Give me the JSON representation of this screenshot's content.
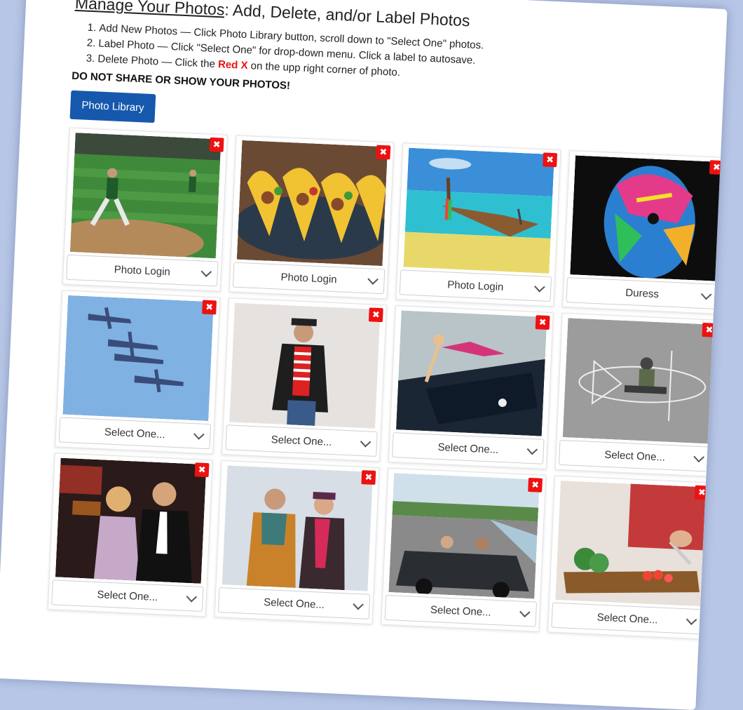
{
  "header": {
    "title_underlined": "Manage Your Photos",
    "title_rest": ": Add, Delete, and/or Label Photos"
  },
  "instructions": [
    {
      "text": "Add New Photos — Click Photo Library button, scroll down to \"Select One\" photos."
    },
    {
      "text": "Label Photo — Click \"Select One\" for drop-down menu. Click a label to autosave."
    },
    {
      "pre": "Delete Photo — Click the ",
      "highlight": "Red X",
      "post": " on the upp right corner of photo."
    }
  ],
  "warning": "DO NOT SHARE OR SHOW YOUR PHOTOS!",
  "library_button": "Photo Library",
  "delete_glyph": "✖",
  "photos": [
    {
      "subject": "baseball-pitcher",
      "label": "Photo Login"
    },
    {
      "subject": "tacos",
      "label": "Photo Login"
    },
    {
      "subject": "longtail-boat-beach",
      "label": "Photo Login"
    },
    {
      "subject": "painted-face",
      "label": "Duress"
    },
    {
      "subject": "fighter-planes",
      "label": "Select One..."
    },
    {
      "subject": "man-in-hat",
      "label": "Select One..."
    },
    {
      "subject": "woman-on-car",
      "label": "Select One..."
    },
    {
      "subject": "airplane-drawing",
      "label": "Select One..."
    },
    {
      "subject": "couple-casino",
      "label": "Select One..."
    },
    {
      "subject": "couple-winter",
      "label": "Select One..."
    },
    {
      "subject": "convertible-road",
      "label": "Select One..."
    },
    {
      "subject": "chopping-vegetables",
      "label": "Select One..."
    }
  ]
}
